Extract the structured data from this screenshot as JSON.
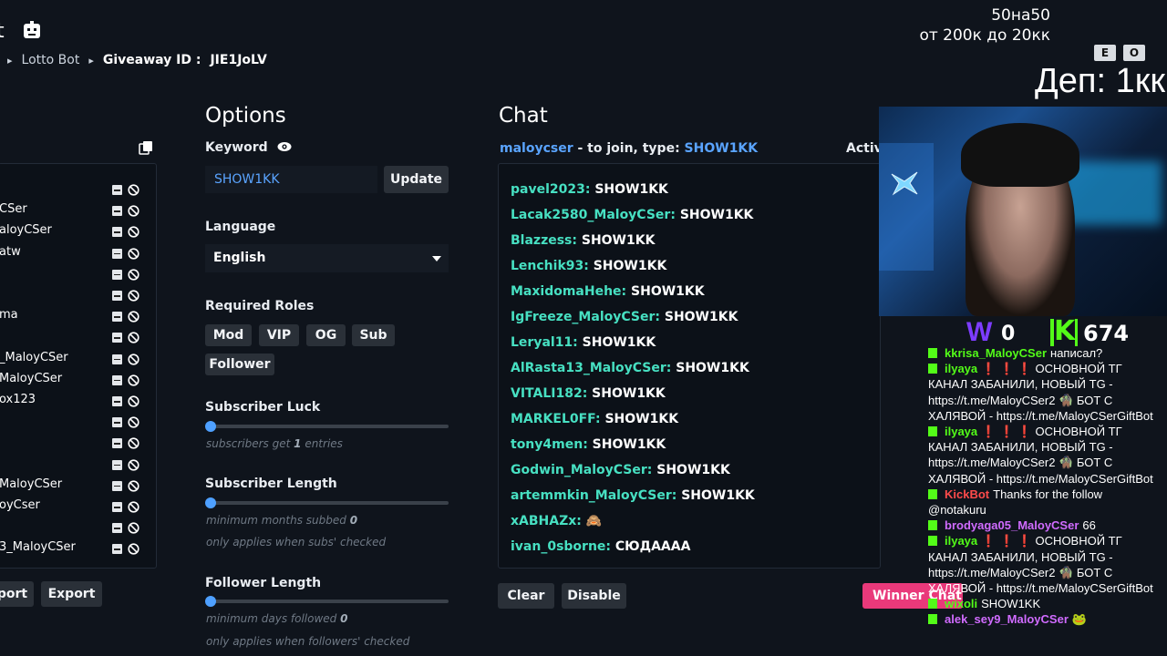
{
  "header": {
    "title_fragment": "t",
    "breadcrumb": [
      "Lotto Bot",
      "Giveaway ID :",
      "JIE1JoLV"
    ]
  },
  "stream_overlay": {
    "line1": "50на50",
    "line2": "от 200к до 20кк",
    "keys": [
      "E",
      "O"
    ],
    "deposit": "Деп: 1кк"
  },
  "participants": {
    "names": [
      "",
      "CSer",
      "aloyCSer",
      "atw",
      "",
      "",
      "ma",
      "",
      "_MaloyCSer",
      "MaloyCSer",
      "ox123",
      "",
      "",
      "",
      "MaloyCSer",
      "oyCser",
      "",
      "3_MaloyCSer"
    ],
    "import_label": "port",
    "export_label": "Export"
  },
  "options": {
    "heading": "Options",
    "keyword_label": "Keyword",
    "keyword_value": "SHOW1KK",
    "update_label": "Update",
    "language_label": "Language",
    "language_value": "English",
    "roles_label": "Required Roles",
    "roles": [
      "Mod",
      "VIP",
      "OG",
      "Sub",
      "Follower"
    ],
    "sub_luck_label": "Subscriber Luck",
    "sub_luck_hint_prefix": "subscribers get",
    "sub_luck_value": "1",
    "sub_luck_hint_suffix": "entries",
    "sub_length_label": "Subscriber Length",
    "sub_length_hint_prefix": "minimum months subbed",
    "sub_length_value": "0",
    "sub_length_note": "only applies when subs' checked",
    "fol_length_label": "Follower Length",
    "fol_length_hint_prefix": "minimum days followed",
    "fol_length_value": "0",
    "fol_length_note": "only applies when followers' checked"
  },
  "chat": {
    "heading": "Chat",
    "join_user": "maloycser",
    "join_text": "- to join, type:",
    "join_keyword": "SHOW1KK",
    "active_label": "Active",
    "messages": [
      {
        "user": "pavel2023:",
        "text": "SHOW1KK"
      },
      {
        "user": "Lacak2580_MaloyCSer:",
        "text": "SHOW1KK"
      },
      {
        "user": "Blazzess:",
        "text": "SHOW1KK"
      },
      {
        "user": "Lenchik93:",
        "text": "SHOW1KK"
      },
      {
        "user": "MaxidomaHehe:",
        "text": "SHOW1KK"
      },
      {
        "user": "IgFreeze_MaloyCSer:",
        "text": "SHOW1KK"
      },
      {
        "user": "Leryal11:",
        "text": "SHOW1KK"
      },
      {
        "user": "AlRasta13_MaloyCSer:",
        "text": "SHOW1KK"
      },
      {
        "user": "VITALI182:",
        "text": "SHOW1KK"
      },
      {
        "user": "MARKEL0FF:",
        "text": "SHOW1KK"
      },
      {
        "user": "tony4men:",
        "text": "SHOW1KK"
      },
      {
        "user": "Godwin_MaloyCSer:",
        "text": "SHOW1KK"
      },
      {
        "user": "artemmkin_MaloyCSer:",
        "text": "SHOW1KK"
      },
      {
        "user": "xABHAZx:",
        "text": "🙈"
      },
      {
        "user": "ivan_0sborne:",
        "text": "СЮДАААА"
      }
    ],
    "clear_label": "Clear",
    "disable_label": "Disable",
    "winner_label": "Winner Chat"
  },
  "counters": {
    "w_label": "W",
    "w_count": "0",
    "k_count": "674"
  },
  "stream_chat": [
    {
      "user": "kkrisa_MaloyCSer",
      "text": "написал?",
      "color": "green"
    },
    {
      "user": "ilyaya",
      "text": "❗ ❗ ❗ ОСНОВНОЙ ТГ",
      "color": "green"
    },
    {
      "user": "",
      "text": "КАНАЛ ЗАБАНИЛИ, НОВЫЙ TG -",
      "color": ""
    },
    {
      "user": "",
      "text": "https://t.me/MaloyCSer2 🧌 БОТ С",
      "color": ""
    },
    {
      "user": "",
      "text": "ХАЛЯВОЙ - https://t.me/MaloyCSerGiftBot",
      "color": ""
    },
    {
      "user": "ilyaya",
      "text": "❗ ❗ ❗ ОСНОВНОЙ ТГ",
      "color": "green"
    },
    {
      "user": "",
      "text": "КАНАЛ ЗАБАНИЛИ, НОВЫЙ TG -",
      "color": ""
    },
    {
      "user": "",
      "text": "https://t.me/MaloyCSer2 🧌 БОТ С",
      "color": ""
    },
    {
      "user": "",
      "text": "ХАЛЯВОЙ - https://t.me/MaloyCSerGiftBot",
      "color": ""
    },
    {
      "user": "KickBot",
      "text": "Thanks for the follow",
      "color": "red"
    },
    {
      "user": "",
      "text": "@notakuru",
      "color": ""
    },
    {
      "user": "brodyaga05_MaloyCSer",
      "text": "66",
      "color": "purple"
    },
    {
      "user": "ilyaya",
      "text": "❗ ❗ ❗ ОСНОВНОЙ ТГ",
      "color": "green"
    },
    {
      "user": "",
      "text": "КАНАЛ ЗАБАНИЛИ, НОВЫЙ TG -",
      "color": ""
    },
    {
      "user": "",
      "text": "https://t.me/MaloyCSer2 🧌 БОТ С",
      "color": ""
    },
    {
      "user": "",
      "text": "ХАЛЯВОЙ - https://t.me/MaloyCSerGiftBot",
      "color": ""
    },
    {
      "user": "wixoli",
      "text": "SHOW1KK",
      "color": "green"
    },
    {
      "user": "alek_sey9_MaloyCSer",
      "text": "🐸",
      "color": "purple"
    }
  ]
}
